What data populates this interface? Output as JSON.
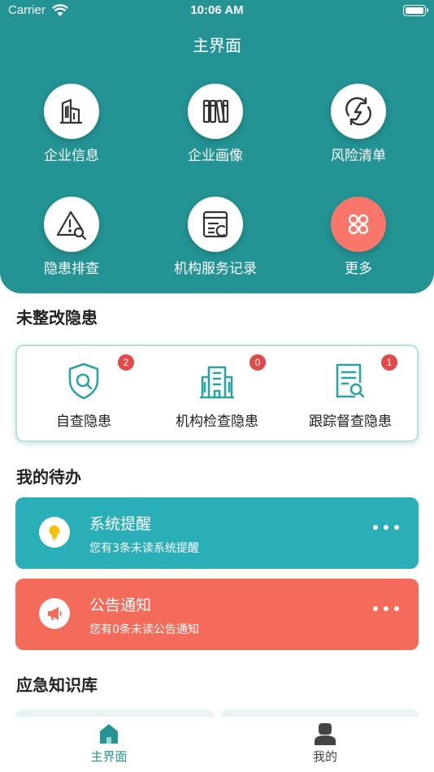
{
  "status_bar": {
    "carrier": "Carrier",
    "time": "10:06 AM"
  },
  "header": {
    "title": "主界面"
  },
  "grid": [
    {
      "label": "企业信息",
      "icon": "building-icon"
    },
    {
      "label": "企业画像",
      "icon": "books-icon"
    },
    {
      "label": "风险清单",
      "icon": "lightning-refresh-icon"
    },
    {
      "label": "隐患排查",
      "icon": "warning-search-icon"
    },
    {
      "label": "机构服务记录",
      "icon": "document-edit-icon"
    },
    {
      "label": "更多",
      "icon": "apps-grid-icon"
    }
  ],
  "hazards": {
    "title": "未整改隐患",
    "items": [
      {
        "label": "自查隐患",
        "count": "2",
        "icon": "shield-search-icon"
      },
      {
        "label": "机构检查隐患",
        "count": "0",
        "icon": "office-building-icon"
      },
      {
        "label": "跟踪督查隐患",
        "count": "1",
        "icon": "document-search-icon"
      }
    ]
  },
  "todos": {
    "title": "我的待办",
    "items": [
      {
        "title": "系统提醒",
        "subtitle": "您有3条未读系统提醒",
        "icon": "lightbulb-icon"
      },
      {
        "title": "公告通知",
        "subtitle": "您有0条未读公告通知",
        "icon": "megaphone-icon"
      }
    ]
  },
  "knowledge": {
    "title": "应急知识库"
  },
  "tabbar": {
    "items": [
      {
        "label": "主界面",
        "icon": "home-icon",
        "active": true
      },
      {
        "label": "我的",
        "icon": "user-icon",
        "active": false
      }
    ]
  },
  "colors": {
    "primary": "#239394",
    "teal_card": "#2aaeb8",
    "coral_card": "#f46b5a",
    "badge": "#e24a4a",
    "more_button": "#f8766a"
  }
}
